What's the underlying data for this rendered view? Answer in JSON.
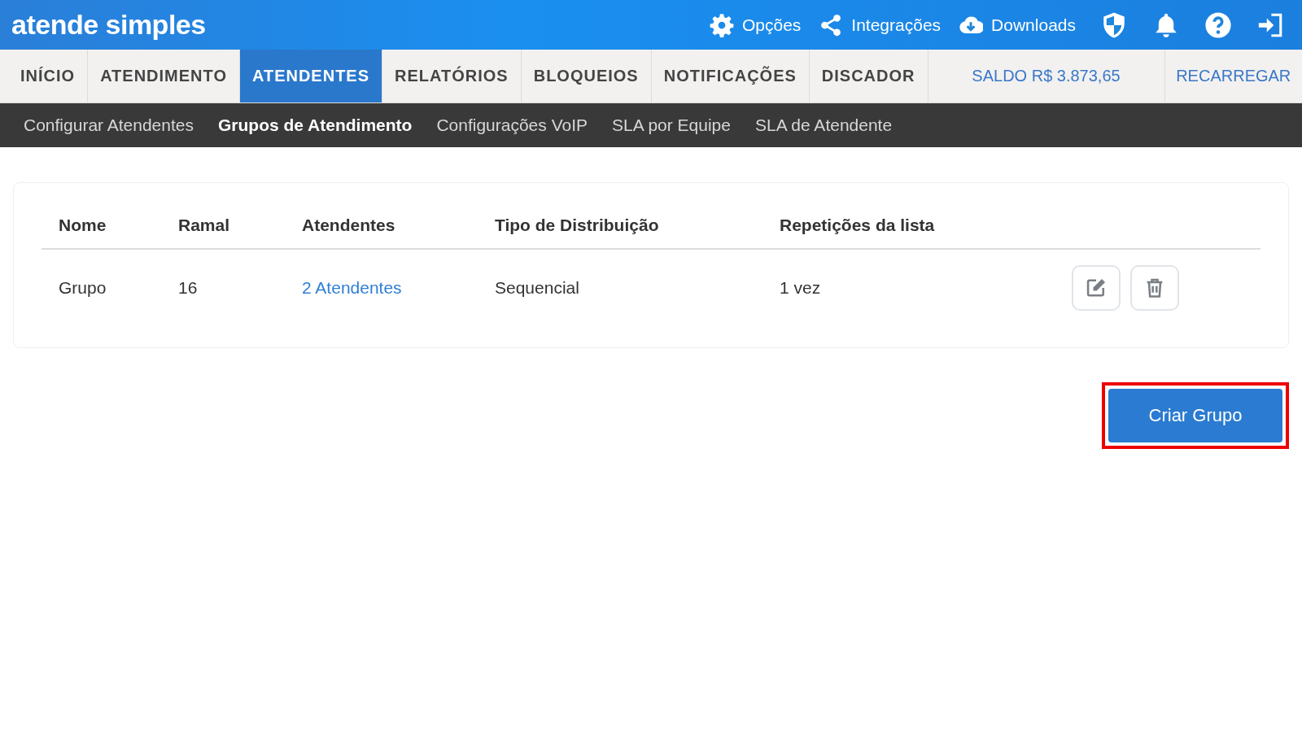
{
  "header": {
    "logo": "atende simples",
    "links": [
      {
        "kind": "gear",
        "label": "Opções"
      },
      {
        "kind": "share",
        "label": "Integrações"
      },
      {
        "kind": "download",
        "label": "Downloads"
      }
    ],
    "icons": [
      {
        "kind": "shield"
      },
      {
        "kind": "bell"
      },
      {
        "kind": "help"
      },
      {
        "kind": "logout"
      }
    ]
  },
  "tabs": [
    {
      "label": "INÍCIO",
      "selected": false
    },
    {
      "label": "ATENDIMENTO",
      "selected": false
    },
    {
      "label": "ATENDENTES",
      "selected": true
    },
    {
      "label": "RELATÓRIOS",
      "selected": false
    },
    {
      "label": "BLOQUEIOS",
      "selected": false
    },
    {
      "label": "NOTIFICAÇÕES",
      "selected": false
    },
    {
      "label": "DISCADOR",
      "selected": false
    }
  ],
  "balance": "SALDO R$ 3.873,65",
  "recharge": "RECARREGAR",
  "subnav": [
    {
      "label": "Configurar Atendentes",
      "selected": false
    },
    {
      "label": "Grupos de Atendimento",
      "selected": true
    },
    {
      "label": "Configurações VoIP",
      "selected": false
    },
    {
      "label": "SLA por Equipe",
      "selected": false
    },
    {
      "label": "SLA de Atendente",
      "selected": false
    }
  ],
  "table": {
    "columns": [
      "Nome",
      "Ramal",
      "Atendentes",
      "Tipo de Distribuição",
      "Repetições da lista"
    ],
    "rows": [
      {
        "cells": [
          "Grupo",
          "16",
          "2 Atendentes",
          "Sequencial",
          "1 vez"
        ]
      }
    ]
  },
  "create_button": {
    "label": "Criar Grupo",
    "highlighted": true
  }
}
